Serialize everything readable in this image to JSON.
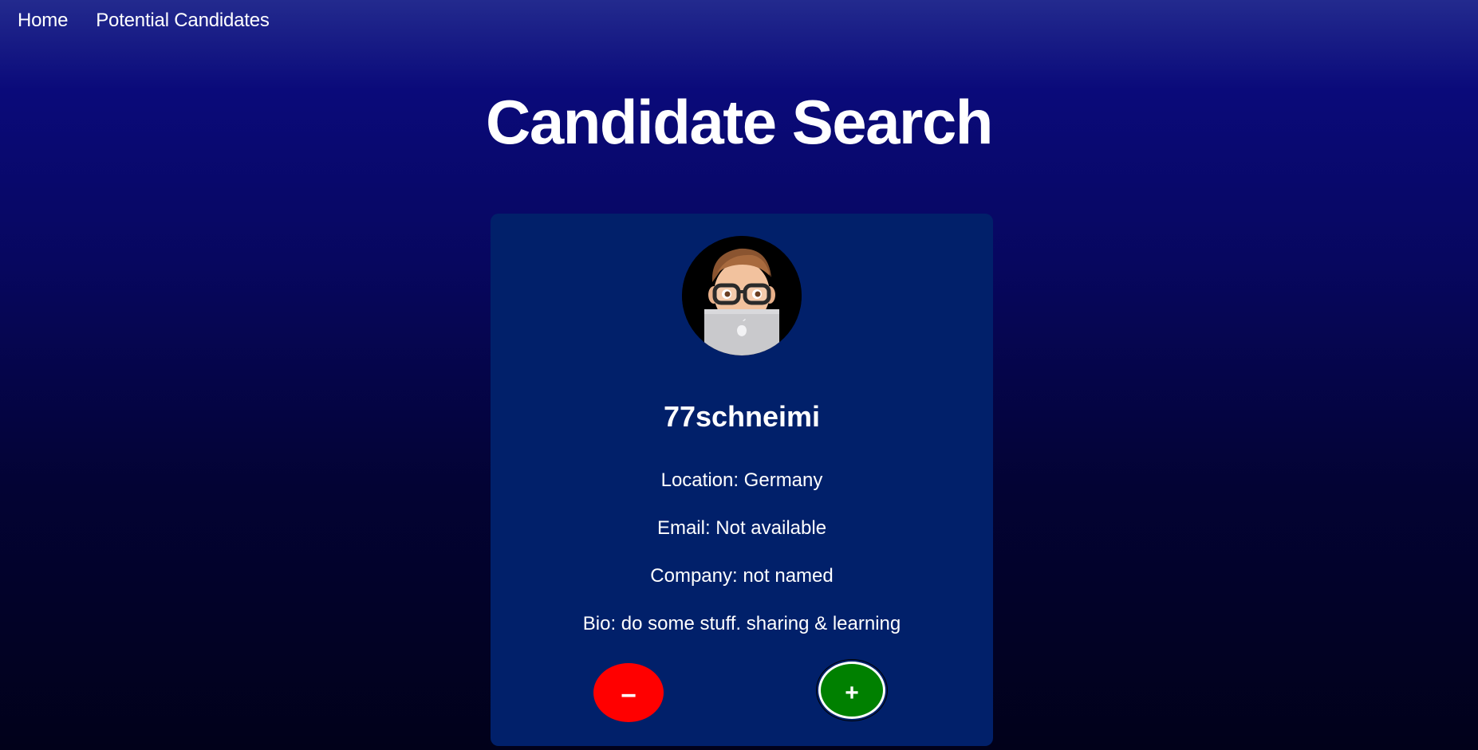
{
  "nav": {
    "home_label": "Home",
    "candidates_label": "Potential Candidates"
  },
  "page": {
    "title": "Candidate Search"
  },
  "candidate": {
    "avatar_icon": "memoji-avatar-with-laptop",
    "username": "77schneimi",
    "location": "Location: Germany",
    "email": "Email: Not available",
    "company": "Company: not named",
    "bio": "Bio: do some stuff. sharing & learning"
  },
  "actions": {
    "reject_label": "−",
    "accept_label": "+"
  },
  "colors": {
    "card_background": "#01206a",
    "reject": "#ff0000",
    "accept": "#008000"
  }
}
